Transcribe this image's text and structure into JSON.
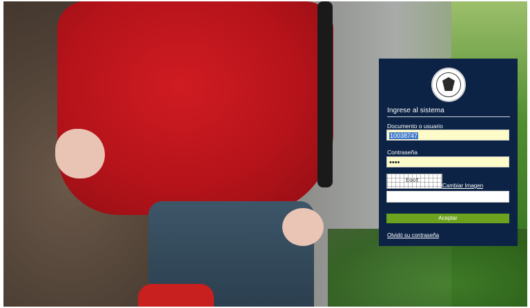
{
  "login": {
    "title": "Ingrese al sistema",
    "user_label": "Documento o usuario",
    "user_value": "10038747",
    "password_label": "Contraseña",
    "password_value": "••••",
    "captcha_text": "Eoot",
    "change_image_link": "Cambiar Imagen",
    "captcha_value": "",
    "submit_label": "Aceptar",
    "forgot_link": "Olvidó su contraseña"
  },
  "colors": {
    "panel_bg": "#0c2346",
    "button_bg": "#6ca21e",
    "field_highlight": "#fdfbc8",
    "selection": "#3f78c9"
  },
  "icons": {
    "logo": "university-seal-icon"
  }
}
